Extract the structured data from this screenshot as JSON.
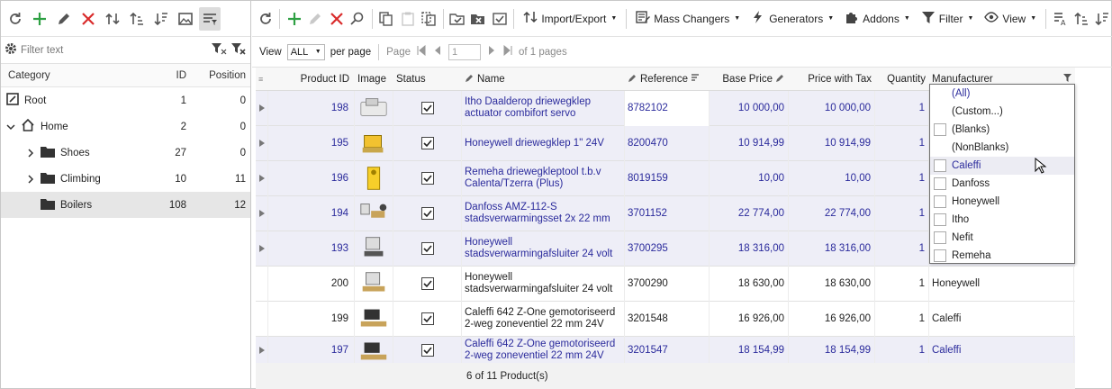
{
  "category_panel": {
    "filter_placeholder": "Filter text",
    "columns": {
      "category": "Category",
      "id": "ID",
      "position": "Position"
    },
    "rows": [
      {
        "name": "Root",
        "id": "1",
        "position": "0"
      },
      {
        "name": "Home",
        "id": "2",
        "position": "0"
      },
      {
        "name": "Shoes",
        "id": "27",
        "position": "0"
      },
      {
        "name": "Climbing",
        "id": "10",
        "position": "11"
      },
      {
        "name": "Boilers",
        "id": "108",
        "position": "12"
      }
    ]
  },
  "toolbar": {
    "import_export": "Import/Export",
    "mass_changers": "Mass Changers",
    "generators": "Generators",
    "addons": "Addons",
    "filter": "Filter",
    "view": "View"
  },
  "pager": {
    "view_label": "View",
    "view_value": "ALL",
    "per_page": "per page",
    "page_label": "Page",
    "page_value": "1",
    "of_pages": "of 1 pages"
  },
  "grid": {
    "columns": {
      "product_id": "Product ID",
      "image": "Image",
      "status": "Status",
      "name": "Name",
      "reference": "Reference",
      "base_price": "Base Price",
      "price_tax": "Price with Tax",
      "quantity": "Quantity",
      "manufacturer": "Manufacturer"
    },
    "rows": [
      {
        "id": "198",
        "name": "Itho Daalderop driewegklep actuator combifort servo",
        "reference": "8782102",
        "base_price": "10 000,00",
        "price_tax": "10 000,00",
        "quantity": "1",
        "manufacturer": ""
      },
      {
        "id": "195",
        "name": "Honeywell driewegklep 1\" 24V",
        "reference": "8200470",
        "base_price": "10 914,99",
        "price_tax": "10 914,99",
        "quantity": "1",
        "manufacturer": ""
      },
      {
        "id": "196",
        "name": "Remeha driewegkleptool t.b.v Calenta/Tzerra (Plus)",
        "reference": "8019159",
        "base_price": "10,00",
        "price_tax": "10,00",
        "quantity": "1",
        "manufacturer": ""
      },
      {
        "id": "194",
        "name": "Danfoss AMZ-112-S stadsverwarmingsset 2x 22 mm",
        "reference": "3701152",
        "base_price": "22 774,00",
        "price_tax": "22 774,00",
        "quantity": "1",
        "manufacturer": ""
      },
      {
        "id": "193",
        "name": "Honeywell stadsverwarmingafsluiter 24 volt",
        "reference": "3700295",
        "base_price": "18 316,00",
        "price_tax": "18 316,00",
        "quantity": "1",
        "manufacturer": ""
      },
      {
        "id": "200",
        "name": "Honeywell stadsverwarmingafsluiter 24 volt",
        "reference": "3700290",
        "base_price": "18 630,00",
        "price_tax": "18 630,00",
        "quantity": "1",
        "manufacturer": "Honeywell"
      },
      {
        "id": "199",
        "name": "Caleffi 642 Z-One gemotoriseerd 2-weg zoneventiel 22 mm 24V",
        "reference": "3201548",
        "base_price": "16 926,00",
        "price_tax": "16 926,00",
        "quantity": "1",
        "manufacturer": "Caleffi"
      },
      {
        "id": "197",
        "name": "Caleffi 642 Z-One gemotoriseerd 2-weg zoneventiel 22 mm 24V",
        "reference": "3201547",
        "base_price": "18 154,99",
        "price_tax": "18 154,99",
        "quantity": "1",
        "manufacturer": "Caleffi"
      }
    ],
    "footer": "6 of 11 Product(s)"
  },
  "manufacturer_filter": {
    "options": [
      "(All)",
      "(Custom...)",
      "(Blanks)",
      "(NonBlanks)",
      "Caleffi",
      "Danfoss",
      "Honeywell",
      "Itho",
      "Nefit",
      "Remeha"
    ]
  },
  "colors": {
    "edited_text": "#2b2b9c",
    "edited_row_bg": "#eeeef7",
    "add_icon": "#2ea043",
    "delete_icon": "#d92b2b"
  }
}
